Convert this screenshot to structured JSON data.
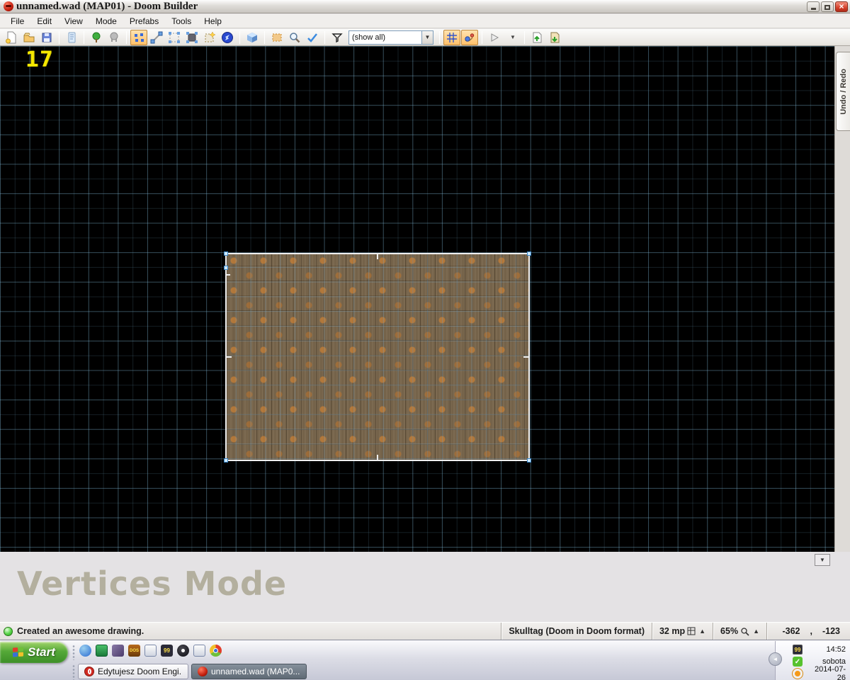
{
  "window": {
    "title": "unnamed.wad (MAP01) - Doom Builder"
  },
  "menu": {
    "items": [
      "File",
      "Edit",
      "View",
      "Mode",
      "Prefabs",
      "Tools",
      "Help"
    ]
  },
  "toolbar": {
    "filter_value": "(show all)"
  },
  "canvas": {
    "vertex_counter": "17",
    "grid_color": "#3c5a6a",
    "selection_color": "#efefef",
    "vertex_color": "#cfeaff"
  },
  "panels": {
    "undo_redo_tab": "Undo / Redo",
    "mode_title": "Vertices Mode"
  },
  "statusbar": {
    "message": "Created an awesome drawing.",
    "game_config": "Skulltag (Doom in Doom format)",
    "grid_size": "32 mp",
    "zoom_level": "65%",
    "mouse_x": "-362",
    "comma": ",",
    "mouse_y": "-123"
  },
  "taskbar": {
    "start_label": "Start",
    "windows": [
      {
        "label": "Edytujesz Doom Engi..."
      },
      {
        "label": "unnamed.wad (MAP0..."
      }
    ],
    "tray": {
      "badge": "99",
      "time": "14:52",
      "weekday": "sobota",
      "date": "2014-07-26"
    }
  },
  "colors": {
    "mode_active_highlight": "#ffc06a",
    "counter_yellow": "#f6e800"
  }
}
